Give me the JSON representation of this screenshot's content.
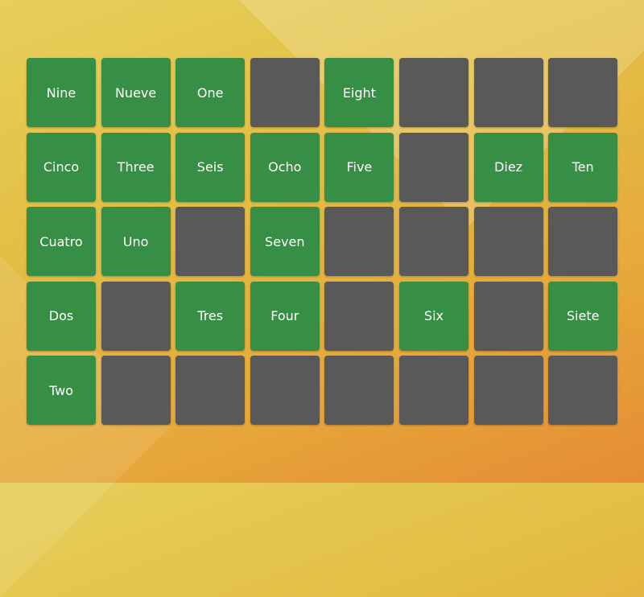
{
  "colors": {
    "revealed": "#378f46",
    "hidden": "#595959"
  },
  "cards": [
    [
      "Nine",
      "Nueve",
      "One",
      "",
      "Eight",
      "",
      "",
      ""
    ],
    [
      "Cinco",
      "Three",
      "Seis",
      "Ocho",
      "Five",
      "",
      "Diez",
      "Ten"
    ],
    [
      "Cuatro",
      "Uno",
      "",
      "Seven",
      "",
      "",
      "",
      ""
    ],
    [
      "Dos",
      "",
      "Tres",
      "Four",
      "",
      "Six",
      "",
      "Siete"
    ],
    [
      "Two",
      "",
      "",
      "",
      "",
      "",
      "",
      ""
    ]
  ]
}
